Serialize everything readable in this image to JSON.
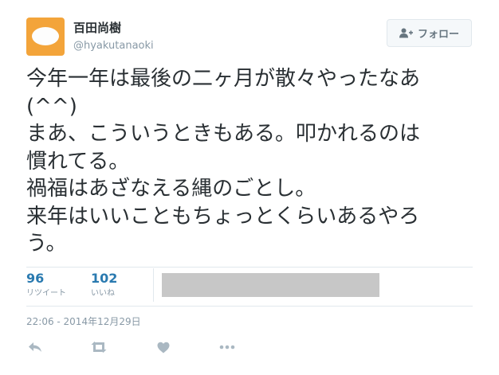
{
  "user": {
    "name": "百田尚樹",
    "handle": "@hyakutanaoki"
  },
  "follow_button": {
    "label": "フォロー"
  },
  "tweet": {
    "text": "今年一年は最後の二ヶ月が散々やったなあ\n(^^)\nまあ、こういうときもある。叩かれるのは\n慣れてる。\n禍福はあざなえる縄のごとし。\n来年はいいこともちょっとくらいあるやろ\nう。"
  },
  "stats": {
    "retweets": {
      "count": "96",
      "label": "リツイート"
    },
    "likes": {
      "count": "102",
      "label": "いいね"
    }
  },
  "timestamp": "22:06 - 2014年12月29日",
  "actions": {
    "reply_icon": "reply-icon",
    "retweet_icon": "retweet-icon",
    "like_icon": "heart-icon",
    "more_icon": "more-icon"
  },
  "colors": {
    "avatar_bg": "#f3a43a",
    "stat_number": "#2a7ab0",
    "secondary_text": "#8899a6",
    "action_icon": "#aab8c2"
  }
}
